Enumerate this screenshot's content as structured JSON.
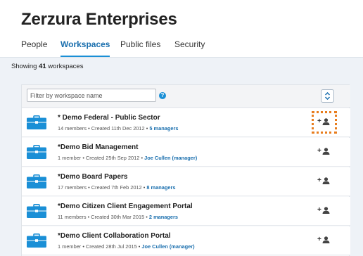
{
  "header": {
    "title": "Zerzura Enterprises",
    "tabs": [
      {
        "label": "People",
        "active": false
      },
      {
        "label": "Workspaces",
        "active": true
      },
      {
        "label": "Public files",
        "active": false
      },
      {
        "label": "Security",
        "active": false
      }
    ]
  },
  "summary": {
    "prefix": "Showing ",
    "count": "41",
    "suffix": " workspaces"
  },
  "filter": {
    "placeholder": "Filter by workspace name",
    "help_label": "?"
  },
  "workspaces": [
    {
      "name": "* Demo Federal - Public Sector",
      "meta": "14 members • Created 11th Dec 2012 • ",
      "link": "5 managers"
    },
    {
      "name": "*Demo Bid Management",
      "meta": "1 member • Created 25th Sep 2012 • ",
      "link": "Joe Cullen (manager)"
    },
    {
      "name": "*Demo Board Papers",
      "meta": "17 members • Created 7th Feb 2012 • ",
      "link": "8 managers"
    },
    {
      "name": "*Demo Citizen Client Engagement Portal",
      "meta": "11 members • Created 30th Mar 2015 • ",
      "link": "2 managers"
    },
    {
      "name": "*Demo Client Collaboration Portal",
      "meta": "1 member • Created 28th Jul 2015 • ",
      "link": "Joe Cullen (manager)"
    }
  ],
  "row_action": {
    "plus": "+"
  },
  "colors": {
    "accent": "#1a8fd6",
    "link": "#1a6fae",
    "briefcase": "#1a8fd6",
    "highlight": "#e87d1e"
  },
  "icons": [
    "help-icon",
    "sort-icon",
    "briefcase-icon",
    "add-manager-icon"
  ]
}
